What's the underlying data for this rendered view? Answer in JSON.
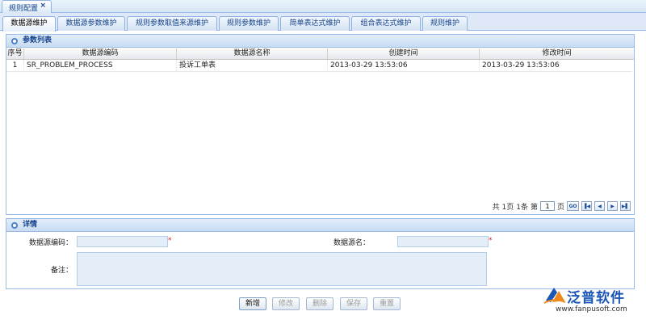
{
  "window_tab": {
    "label": "规则配置",
    "close": "×"
  },
  "tabs": [
    {
      "label": "数据源维护",
      "active": true
    },
    {
      "label": "数据源参数维护",
      "active": false
    },
    {
      "label": "规则参数取值来源维护",
      "active": false
    },
    {
      "label": "规则参数维护",
      "active": false
    },
    {
      "label": "简单表达式维护",
      "active": false
    },
    {
      "label": "组合表达式维护",
      "active": false
    },
    {
      "label": "规则维护",
      "active": false
    }
  ],
  "param_list": {
    "title": "参数列表",
    "columns": [
      "序号",
      "数据源编码",
      "数据源名称",
      "创建时间",
      "修改时间"
    ],
    "rows": [
      {
        "no": "1",
        "code": "SR_PROBLEM_PROCESS",
        "name": "投诉工单表",
        "created": "2013-03-29 13:53:06",
        "modified": "2013-03-29 13:53:06"
      }
    ]
  },
  "pager": {
    "total_pages_text": "共 1页",
    "total_items_text": "1条",
    "page_prefix": "第",
    "page_value": "1",
    "page_suffix": "页",
    "go_label": "GO"
  },
  "detail": {
    "title": "详情",
    "code_label": "数据源编码：",
    "name_label": "数据源名：",
    "remark_label": "备注：",
    "required_mark": "*",
    "code_value": "",
    "name_value": "",
    "remark_value": ""
  },
  "actions": [
    {
      "label": "新增",
      "enabled": true
    },
    {
      "label": "修改",
      "enabled": false
    },
    {
      "label": "删除",
      "enabled": false
    },
    {
      "label": "保存",
      "enabled": false
    },
    {
      "label": "重置",
      "enabled": false
    }
  ],
  "logo": {
    "text": "泛普软件",
    "url": "www.fanpusoft.com"
  },
  "colors": {
    "accent": "#15428b",
    "border": "#99bbe8",
    "input_bg": "#e3eef8",
    "required": "#e02020",
    "logo_blue": "#1a56b6"
  }
}
